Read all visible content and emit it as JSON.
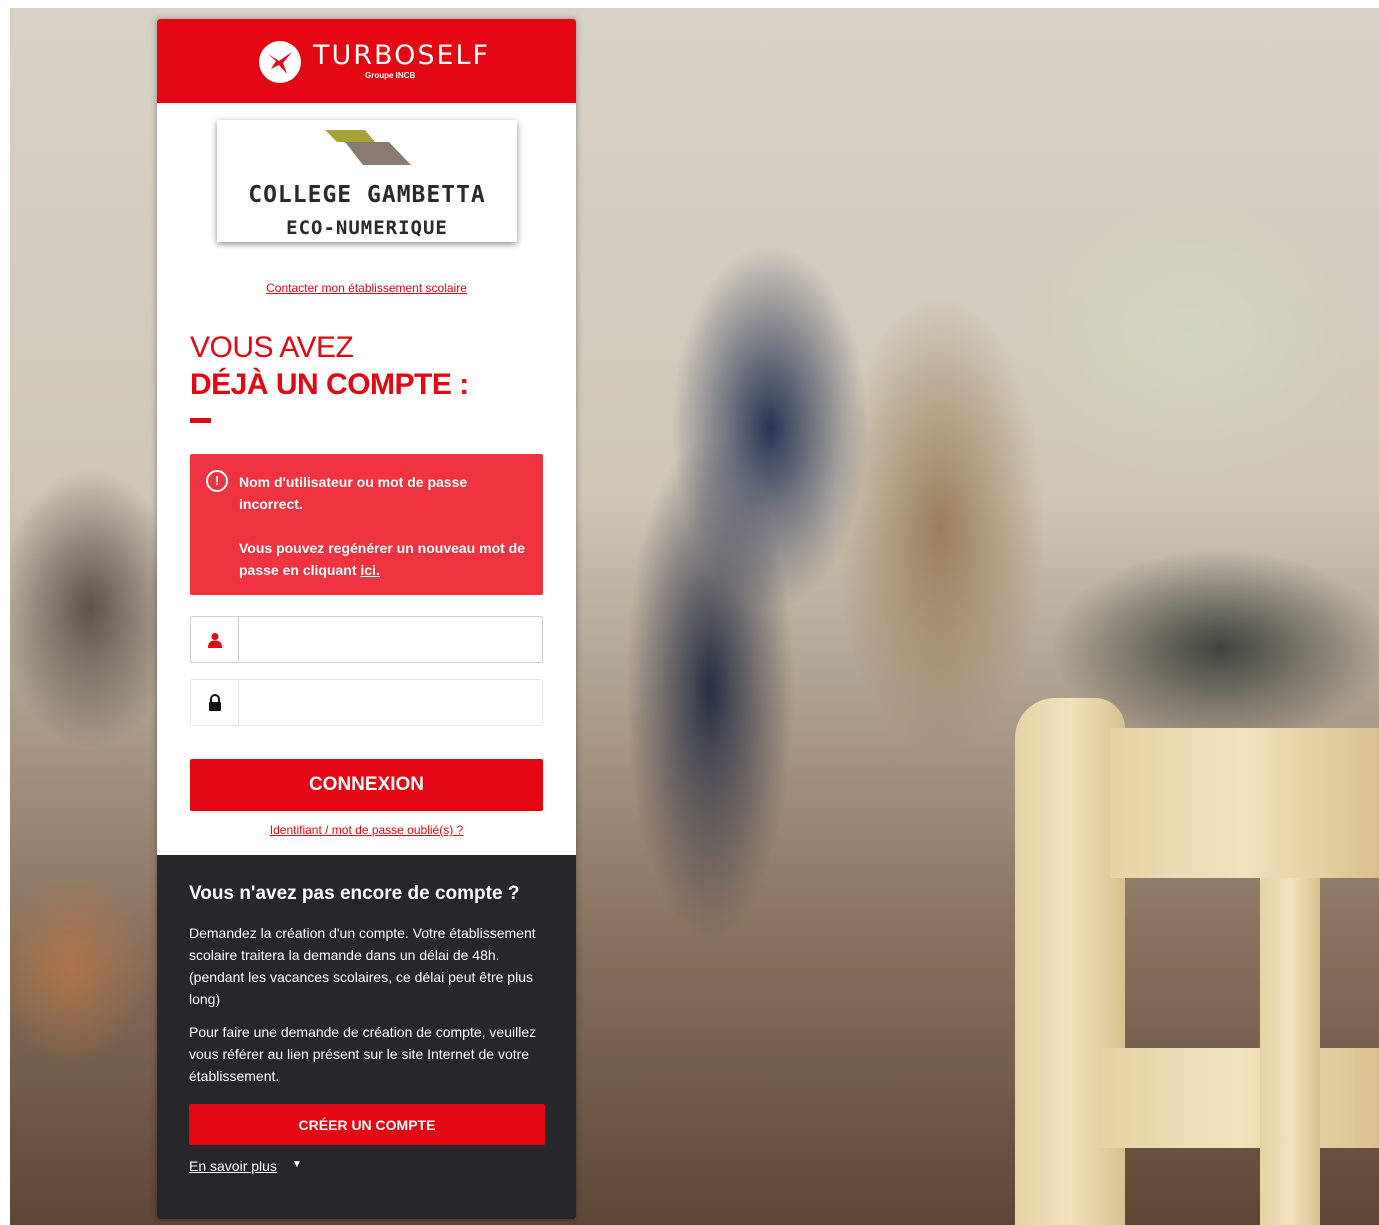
{
  "brand": {
    "name": "TURBOSELF",
    "subtitle": "Groupe INCB",
    "accent_color": "#e30613",
    "icon": "hummingbird-logo-icon"
  },
  "school": {
    "name": "COLLEGE GAMBETTA",
    "subtitle": "ECO-NUMERIQUE",
    "contact_link": "Contacter mon établissement scolaire"
  },
  "login": {
    "title_light": "VOUS AVEZ",
    "title_bold": "DÉJÀ UN COMPTE :",
    "error": {
      "icon": "alert-circle-icon",
      "line1": "Nom d'utilisateur ou mot de passe incorrect.",
      "line2_prefix": "Vous pouvez regénérer un nouveau mot de passe en cliquant ",
      "line2_link": "ici.",
      "bg_color": "#ef3340"
    },
    "username": {
      "icon": "user-icon",
      "value": "",
      "placeholder": ""
    },
    "password": {
      "icon": "lock-icon",
      "value": "",
      "placeholder": ""
    },
    "submit_label": "CONNEXION",
    "forgot_link": "Identifiant / mot de passe oublié(s) ?"
  },
  "signup": {
    "title": "Vous n'avez pas encore de compte ?",
    "paragraph1": "Demandez la création d'un compte. Votre établissement scolaire traitera la demande dans un délai de 48h. (pendant les vacances scolaires, ce délai peut être plus long)",
    "paragraph2": "Pour faire une demande de création de compte, veuillez vous référer au lien présent sur le site Internet de votre établissement.",
    "create_label": "CRÉER UN COMPTE",
    "more_link": "En savoir plus",
    "more_icon": "chevron-down-icon",
    "bg_color": "#26262b"
  }
}
